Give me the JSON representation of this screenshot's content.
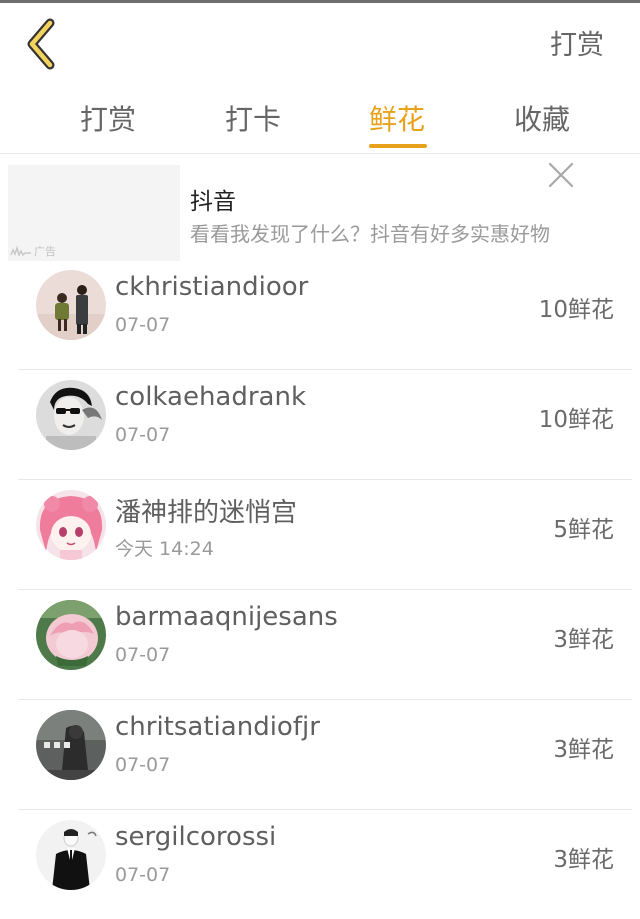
{
  "header": {
    "reward_label": "打赏"
  },
  "tabs": [
    {
      "label": "打赏"
    },
    {
      "label": "打卡"
    },
    {
      "label": "鲜花"
    },
    {
      "label": "收藏"
    }
  ],
  "ad": {
    "title": "抖音",
    "description": "看看我发现了什么？抖音有好多实惠好物",
    "tag": "广告"
  },
  "list": [
    {
      "name": "ckhristiandioor",
      "time": "07-07",
      "amount": "10鲜花"
    },
    {
      "name": "colkaehadrank",
      "time": "07-07",
      "amount": "10鲜花"
    },
    {
      "name": "潘神排的迷悄宫",
      "time": "今天 14:24",
      "amount": "5鲜花"
    },
    {
      "name": "barmaaqnijesans",
      "time": "07-07",
      "amount": "3鲜花"
    },
    {
      "name": "chritsatiandiofjr",
      "time": "07-07",
      "amount": "3鲜花"
    },
    {
      "name": "sergilcorossi",
      "time": "07-07",
      "amount": "3鲜花"
    }
  ],
  "colors": {
    "accent": "#e8a11b",
    "back_icon_fill": "#f3d35c"
  }
}
